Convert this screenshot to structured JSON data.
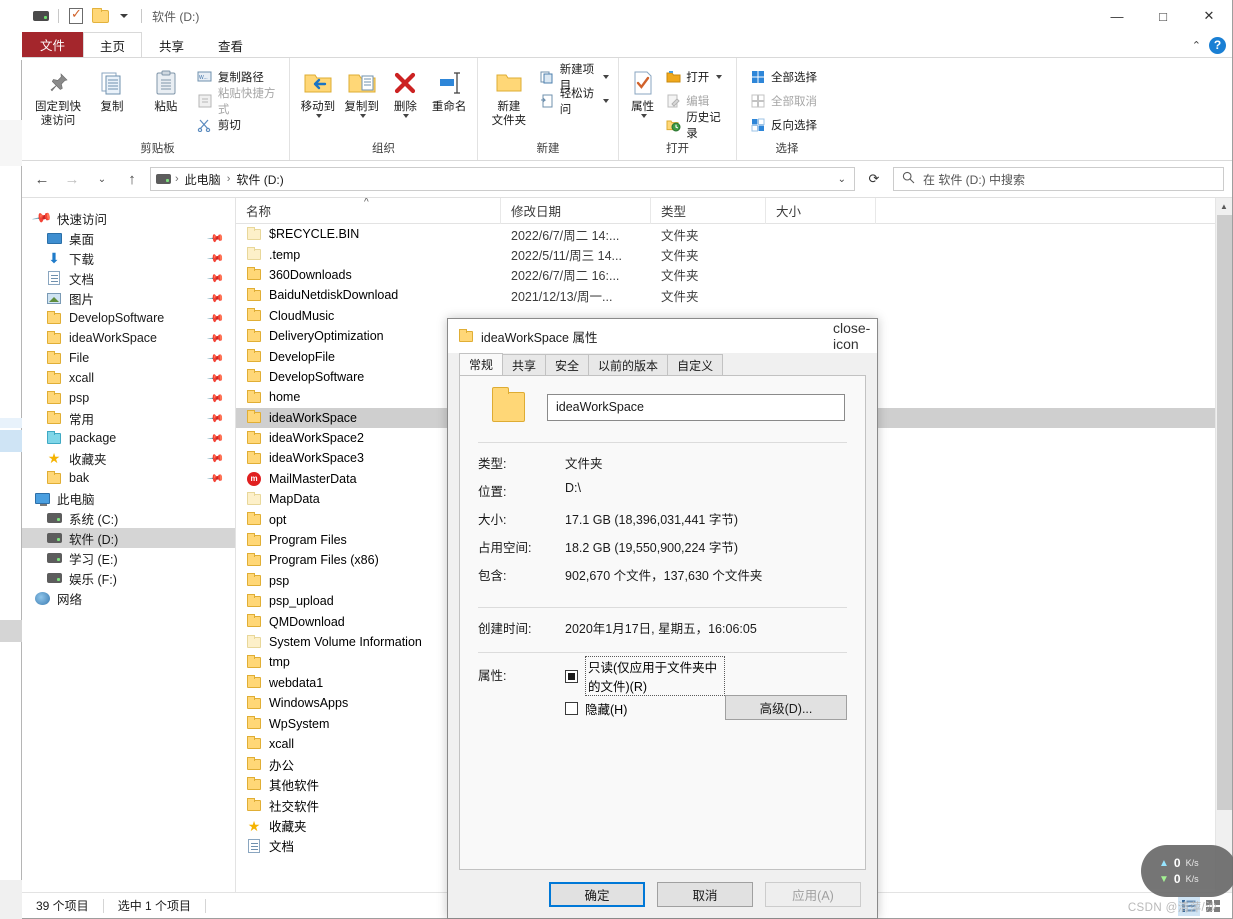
{
  "window": {
    "title": "软件 (D:)",
    "quick_access_icons": [
      "drive-icon",
      "checkbox-properties-icon",
      "new-folder-icon",
      "customize-caret-icon"
    ],
    "controls": {
      "minimize": "—",
      "maximize": "□",
      "close": "✕",
      "collapse_ribbon": "⌃",
      "help": "?"
    }
  },
  "ribbon": {
    "tabs": [
      {
        "label": "文件",
        "kind": "file"
      },
      {
        "label": "主页",
        "kind": "normal",
        "active": true
      },
      {
        "label": "共享",
        "kind": "normal"
      },
      {
        "label": "查看",
        "kind": "normal"
      }
    ],
    "groups": [
      {
        "label": "剪贴板",
        "big": [
          {
            "label_line1": "固定到快",
            "label_line2": "速访问",
            "icon": "pin-icon"
          },
          {
            "label_line1": "复制",
            "label_line2": "",
            "icon": "copy-icon"
          },
          {
            "label_line1": "粘贴",
            "label_line2": "",
            "icon": "paste-icon"
          }
        ],
        "small": [
          {
            "label": "复制路径",
            "icon": "copy-path-icon",
            "disabled": false
          },
          {
            "label": "粘贴快捷方式",
            "icon": "paste-shortcut-icon",
            "disabled": true
          },
          {
            "label": "剪切",
            "icon": "scissors-icon",
            "disabled": false
          }
        ]
      },
      {
        "label": "组织",
        "big": [
          {
            "label_line1": "移动到",
            "label_line2": "",
            "icon": "move-to-icon",
            "has_caret": true
          },
          {
            "label_line1": "复制到",
            "label_line2": "",
            "icon": "copy-to-icon",
            "has_caret": true
          },
          {
            "label_line1": "删除",
            "label_line2": "",
            "icon": "delete-x-icon",
            "has_caret": true
          },
          {
            "label_line1": "重命名",
            "label_line2": "",
            "icon": "rename-icon"
          }
        ],
        "small": []
      },
      {
        "label": "新建",
        "big": [
          {
            "label_line1": "新建",
            "label_line2": "文件夹",
            "icon": "new-folder-icon"
          }
        ],
        "small": [
          {
            "label": "新建项目",
            "icon": "new-item-icon",
            "has_caret": true
          },
          {
            "label": "轻松访问",
            "icon": "easy-access-icon",
            "has_caret": true
          }
        ]
      },
      {
        "label": "打开",
        "big": [
          {
            "label_line1": "属性",
            "label_line2": "",
            "icon": "properties-icon",
            "has_caret": true
          }
        ],
        "small": [
          {
            "label": "打开",
            "icon": "open-folder-icon",
            "has_caret": true
          },
          {
            "label": "编辑",
            "icon": "edit-icon",
            "disabled": true
          },
          {
            "label": "历史记录",
            "icon": "history-icon"
          }
        ]
      },
      {
        "label": "选择",
        "big": [],
        "small": [
          {
            "label": "全部选择",
            "icon": "select-all-icon"
          },
          {
            "label": "全部取消",
            "icon": "select-none-icon",
            "disabled": true
          },
          {
            "label": "反向选择",
            "icon": "invert-selection-icon"
          }
        ]
      }
    ]
  },
  "addressbar": {
    "back_icon": "back-arrow-icon",
    "forward_icon": "forward-arrow-icon",
    "recent_icon": "recent-locations-icon",
    "up_icon": "up-arrow-icon",
    "drive_icon": "drive-icon",
    "breadcrumbs": [
      "此电脑",
      "软件 (D:)"
    ],
    "dropdown_icon": "chevron-down-icon",
    "refresh_icon": "refresh-icon"
  },
  "search": {
    "icon": "search-icon",
    "placeholder": "在 软件 (D:) 中搜索"
  },
  "navpane": {
    "items": [
      {
        "label": "快速访问",
        "icon": "star-pin-icon",
        "indent": 0,
        "pinned": false,
        "selected": false
      },
      {
        "label": "桌面",
        "icon": "desktop-icon",
        "indent": 1,
        "pinned": true
      },
      {
        "label": "下载",
        "icon": "downloads-icon",
        "indent": 1,
        "pinned": true
      },
      {
        "label": "文档",
        "icon": "documents-icon",
        "indent": 1,
        "pinned": true
      },
      {
        "label": "图片",
        "icon": "pictures-icon",
        "indent": 1,
        "pinned": true
      },
      {
        "label": "DevelopSoftware",
        "icon": "folder-icon",
        "indent": 1,
        "pinned": true
      },
      {
        "label": "ideaWorkSpace",
        "icon": "folder-icon",
        "indent": 1,
        "pinned": true
      },
      {
        "label": "File",
        "icon": "folder-icon",
        "indent": 1,
        "pinned": true
      },
      {
        "label": "xcall",
        "icon": "folder-icon",
        "indent": 1,
        "pinned": true
      },
      {
        "label": "psp",
        "icon": "folder-icon",
        "indent": 1,
        "pinned": true
      },
      {
        "label": "常用",
        "icon": "folder-icon",
        "indent": 1,
        "pinned": true
      },
      {
        "label": "package",
        "icon": "folder-cyan-icon",
        "indent": 1,
        "pinned": true
      },
      {
        "label": "收藏夹",
        "icon": "favorites-star-icon",
        "indent": 1,
        "pinned": true
      },
      {
        "label": "bak",
        "icon": "folder-icon",
        "indent": 1,
        "pinned": true
      },
      {
        "label": "此电脑",
        "icon": "this-pc-icon",
        "indent": 0,
        "pinned": false
      },
      {
        "label": "系统 (C:)",
        "icon": "system-drive-icon",
        "indent": 1,
        "pinned": false
      },
      {
        "label": "软件 (D:)",
        "icon": "drive-icon",
        "indent": 1,
        "pinned": false,
        "selected": true
      },
      {
        "label": "学习 (E:)",
        "icon": "drive-icon",
        "indent": 1,
        "pinned": false
      },
      {
        "label": "娱乐 (F:)",
        "icon": "drive-icon",
        "indent": 1,
        "pinned": false
      },
      {
        "label": "网络",
        "icon": "network-icon",
        "indent": 0,
        "pinned": false
      }
    ]
  },
  "filelist": {
    "columns": [
      {
        "key": "name",
        "label": "名称",
        "sorted": true,
        "sort_dir": "asc"
      },
      {
        "key": "date",
        "label": "修改日期"
      },
      {
        "key": "type",
        "label": "类型"
      },
      {
        "key": "size",
        "label": "大小"
      }
    ],
    "rows": [
      {
        "name": "$RECYCLE.BIN",
        "icon": "folder-pale-icon",
        "date": "2022/6/7/周二 14:...",
        "type": "文件夹",
        "size": ""
      },
      {
        "name": ".temp",
        "icon": "folder-pale-icon",
        "date": "2022/5/11/周三 14...",
        "type": "文件夹",
        "size": ""
      },
      {
        "name": "360Downloads",
        "icon": "folder-icon",
        "date": "2022/6/7/周二 16:...",
        "type": "文件夹",
        "size": ""
      },
      {
        "name": "BaiduNetdiskDownload",
        "icon": "folder-icon",
        "date": "2021/12/13/周一...",
        "type": "文件夹",
        "size": ""
      },
      {
        "name": "CloudMusic",
        "icon": "folder-icon",
        "date": "",
        "type": "",
        "size": ""
      },
      {
        "name": "DeliveryOptimization",
        "icon": "folder-icon",
        "date": "",
        "type": "",
        "size": ""
      },
      {
        "name": "DevelopFile",
        "icon": "folder-icon",
        "date": "",
        "type": "",
        "size": ""
      },
      {
        "name": "DevelopSoftware",
        "icon": "folder-icon",
        "date": "",
        "type": "",
        "size": ""
      },
      {
        "name": "home",
        "icon": "folder-icon",
        "date": "",
        "type": "",
        "size": ""
      },
      {
        "name": "ideaWorkSpace",
        "icon": "folder-icon",
        "date": "",
        "type": "",
        "size": "",
        "selected": true
      },
      {
        "name": "ideaWorkSpace2",
        "icon": "folder-icon",
        "date": "",
        "type": "",
        "size": ""
      },
      {
        "name": "ideaWorkSpace3",
        "icon": "folder-icon",
        "date": "",
        "type": "",
        "size": ""
      },
      {
        "name": "MailMasterData",
        "icon": "mail-master-icon",
        "date": "",
        "type": "",
        "size": ""
      },
      {
        "name": "MapData",
        "icon": "folder-pale-icon",
        "date": "",
        "type": "",
        "size": ""
      },
      {
        "name": "opt",
        "icon": "folder-icon",
        "date": "",
        "type": "",
        "size": ""
      },
      {
        "name": "Program Files",
        "icon": "folder-icon",
        "date": "",
        "type": "",
        "size": ""
      },
      {
        "name": "Program Files (x86)",
        "icon": "folder-icon",
        "date": "",
        "type": "",
        "size": ""
      },
      {
        "name": "psp",
        "icon": "folder-icon",
        "date": "",
        "type": "",
        "size": ""
      },
      {
        "name": "psp_upload",
        "icon": "folder-icon",
        "date": "",
        "type": "",
        "size": ""
      },
      {
        "name": "QMDownload",
        "icon": "folder-icon",
        "date": "",
        "type": "",
        "size": ""
      },
      {
        "name": "System Volume Information",
        "icon": "folder-pale-icon",
        "date": "",
        "type": "",
        "size": ""
      },
      {
        "name": "tmp",
        "icon": "folder-icon",
        "date": "",
        "type": "",
        "size": ""
      },
      {
        "name": "webdata1",
        "icon": "folder-icon",
        "date": "",
        "type": "",
        "size": ""
      },
      {
        "name": "WindowsApps",
        "icon": "folder-icon",
        "date": "",
        "type": "",
        "size": ""
      },
      {
        "name": "WpSystem",
        "icon": "folder-icon",
        "date": "",
        "type": "",
        "size": ""
      },
      {
        "name": "xcall",
        "icon": "folder-icon",
        "date": "",
        "type": "",
        "size": ""
      },
      {
        "name": "办公",
        "icon": "folder-icon",
        "date": "",
        "type": "",
        "size": ""
      },
      {
        "name": "其他软件",
        "icon": "folder-icon",
        "date": "",
        "type": "",
        "size": ""
      },
      {
        "name": "社交软件",
        "icon": "folder-icon",
        "date": "",
        "type": "",
        "size": ""
      },
      {
        "name": "收藏夹",
        "icon": "favorites-star-icon",
        "date": "",
        "type": "",
        "size": ""
      },
      {
        "name": "文档",
        "icon": "documents-icon",
        "date": "",
        "type": "",
        "size": ""
      }
    ]
  },
  "statusbar": {
    "item_count": "39 个项目",
    "selection": "选中 1 个项目",
    "view_details_icon": "details-view-icon",
    "view_tiles_icon": "large-icons-view-icon"
  },
  "dialog": {
    "title": "ideaWorkSpace 属性",
    "title_icon": "folder-icon",
    "close_icon": "close-icon",
    "tabs": [
      {
        "label": "常规",
        "active": true
      },
      {
        "label": "共享",
        "active": false
      },
      {
        "label": "安全",
        "active": false
      },
      {
        "label": "以前的版本",
        "active": false
      },
      {
        "label": "自定义",
        "active": false
      }
    ],
    "folder_icon": "big-folder-icon",
    "name_value": "ideaWorkSpace",
    "fields": [
      {
        "label": "类型:",
        "value": "文件夹"
      },
      {
        "label": "位置:",
        "value": "D:\\"
      },
      {
        "label": "大小:",
        "value": "17.1 GB (18,396,031,441 字节)"
      },
      {
        "label": "占用空间:",
        "value": "18.2 GB (19,550,900,224 字节)"
      },
      {
        "label": "包含:",
        "value": "902,670 个文件，137,630 个文件夹"
      }
    ],
    "created": {
      "label": "创建时间:",
      "value": "2020年1月17日, 星期五，16:06:05"
    },
    "attributes": {
      "label": "属性:",
      "readonly": {
        "label": "只读(仅应用于文件夹中的文件)(R)",
        "state": "mixed"
      },
      "hidden": {
        "label": "隐藏(H)",
        "state": "unchecked"
      },
      "advanced_button": "高级(D)..."
    },
    "buttons": [
      {
        "label": "确定",
        "kind": "default"
      },
      {
        "label": "取消",
        "kind": "normal"
      },
      {
        "label": "应用(A)",
        "kind": "disabled"
      }
    ]
  },
  "overlay": {
    "net_up": {
      "value": "0",
      "unit": "K/s",
      "icon": "upload-arrow-icon"
    },
    "net_down": {
      "value": "0",
      "unit": "K/s",
      "icon": "download-arrow-icon"
    },
    "watermark": "CSDN @清萍/沙"
  }
}
